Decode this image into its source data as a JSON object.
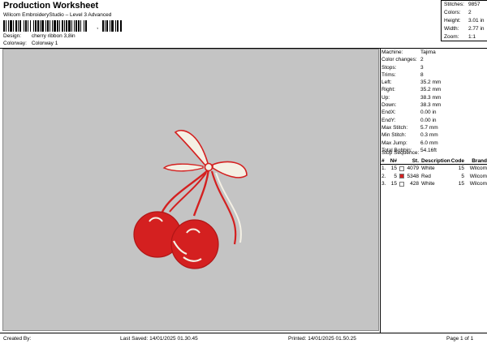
{
  "header": {
    "title": "Production Worksheet",
    "subtitle": "Wilcom EmbroideryStudio – Level 3 Advanced",
    "barcode_suffix": ","
  },
  "design": {
    "design_label": "Design:",
    "design_value": "cherry ribbon 3,8in",
    "colorway_label": "Colorway:",
    "colorway_value": "Colorway 1"
  },
  "stats": [
    {
      "label": "Stitches:",
      "value": "9857"
    },
    {
      "label": "Colors:",
      "value": "2"
    },
    {
      "label": "Height:",
      "value": "3.01 in"
    },
    {
      "label": "Width:",
      "value": "2.77 in"
    },
    {
      "label": "Zoom:",
      "value": "1:1"
    }
  ],
  "machine_info": [
    {
      "label": "Machine:",
      "value": "Tajima"
    },
    {
      "label": "Color changes:",
      "value": "2"
    },
    {
      "label": "Stops:",
      "value": "3"
    },
    {
      "label": "Trims:",
      "value": "8"
    },
    {
      "label": "Left:",
      "value": "35.2 mm"
    },
    {
      "label": "Right:",
      "value": "35.2 mm"
    },
    {
      "label": "Up:",
      "value": "38.3 mm"
    },
    {
      "label": "Down:",
      "value": "38.3 mm"
    },
    {
      "label": "EndX:",
      "value": "0.00 in"
    },
    {
      "label": "EndY:",
      "value": "0.00 in"
    },
    {
      "label": "Max Stitch:",
      "value": "5.7 mm"
    },
    {
      "label": "Min Stitch:",
      "value": "0.3 mm"
    },
    {
      "label": "Max Jump:",
      "value": "6.0 mm"
    },
    {
      "label": "Total Bobbin:",
      "value": "54.16ft"
    }
  ],
  "stop_sequence": {
    "title": "Stop Sequence:",
    "headers": {
      "num": "#",
      "no": "N#",
      "st": "St.",
      "desc": "Description",
      "code": "Code",
      "brand": "Brand"
    },
    "rows": [
      {
        "num": "1.",
        "no": "15",
        "color": "#ffffff",
        "st": "4079",
        "desc": "White",
        "code": "15",
        "brand": "Wilcom"
      },
      {
        "num": "2.",
        "no": "5",
        "color": "#d42020",
        "st": "5348",
        "desc": "Red",
        "code": "5",
        "brand": "Wilcom"
      },
      {
        "num": "3.",
        "no": "15",
        "color": "#ffffff",
        "st": "428",
        "desc": "White",
        "code": "15",
        "brand": "Wilcom"
      }
    ]
  },
  "footer": {
    "created_by": "Created By:",
    "last_saved": "Last Saved: 14/01/2025 01.30.45",
    "printed": "Printed: 14/01/2025 01.50.25",
    "page": "Page 1 of 1"
  },
  "colors": {
    "canvas_bg": "#c4c4c4",
    "thread_red": "#d42020",
    "thread_white": "#f4f0e4"
  }
}
